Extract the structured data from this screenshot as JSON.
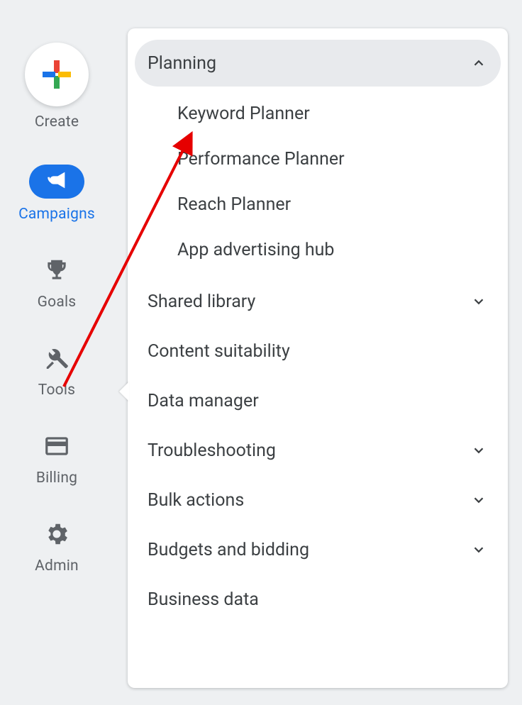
{
  "sidebar": {
    "create": {
      "label": "Create"
    },
    "items": [
      {
        "key": "campaigns",
        "label": "Campaigns",
        "active": true
      },
      {
        "key": "goals",
        "label": "Goals"
      },
      {
        "key": "tools",
        "label": "Tools"
      },
      {
        "key": "billing",
        "label": "Billing"
      },
      {
        "key": "admin",
        "label": "Admin"
      }
    ]
  },
  "tools_menu": {
    "planning": {
      "label": "Planning",
      "expanded": true,
      "items": [
        {
          "label": "Keyword Planner"
        },
        {
          "label": "Performance Planner"
        },
        {
          "label": "Reach Planner"
        },
        {
          "label": "App advertising hub"
        }
      ]
    },
    "rest": [
      {
        "label": "Shared library",
        "has_children": true
      },
      {
        "label": "Content suitability",
        "has_children": false
      },
      {
        "label": "Data manager",
        "has_children": false
      },
      {
        "label": "Troubleshooting",
        "has_children": true
      },
      {
        "label": "Bulk actions",
        "has_children": true
      },
      {
        "label": "Budgets and bidding",
        "has_children": true
      },
      {
        "label": "Business data",
        "has_children": false
      }
    ]
  },
  "annotation": {
    "type": "arrow",
    "from": "sidebar-item-tools",
    "to": "menu-item-keyword-planner",
    "color": "#e60000"
  }
}
